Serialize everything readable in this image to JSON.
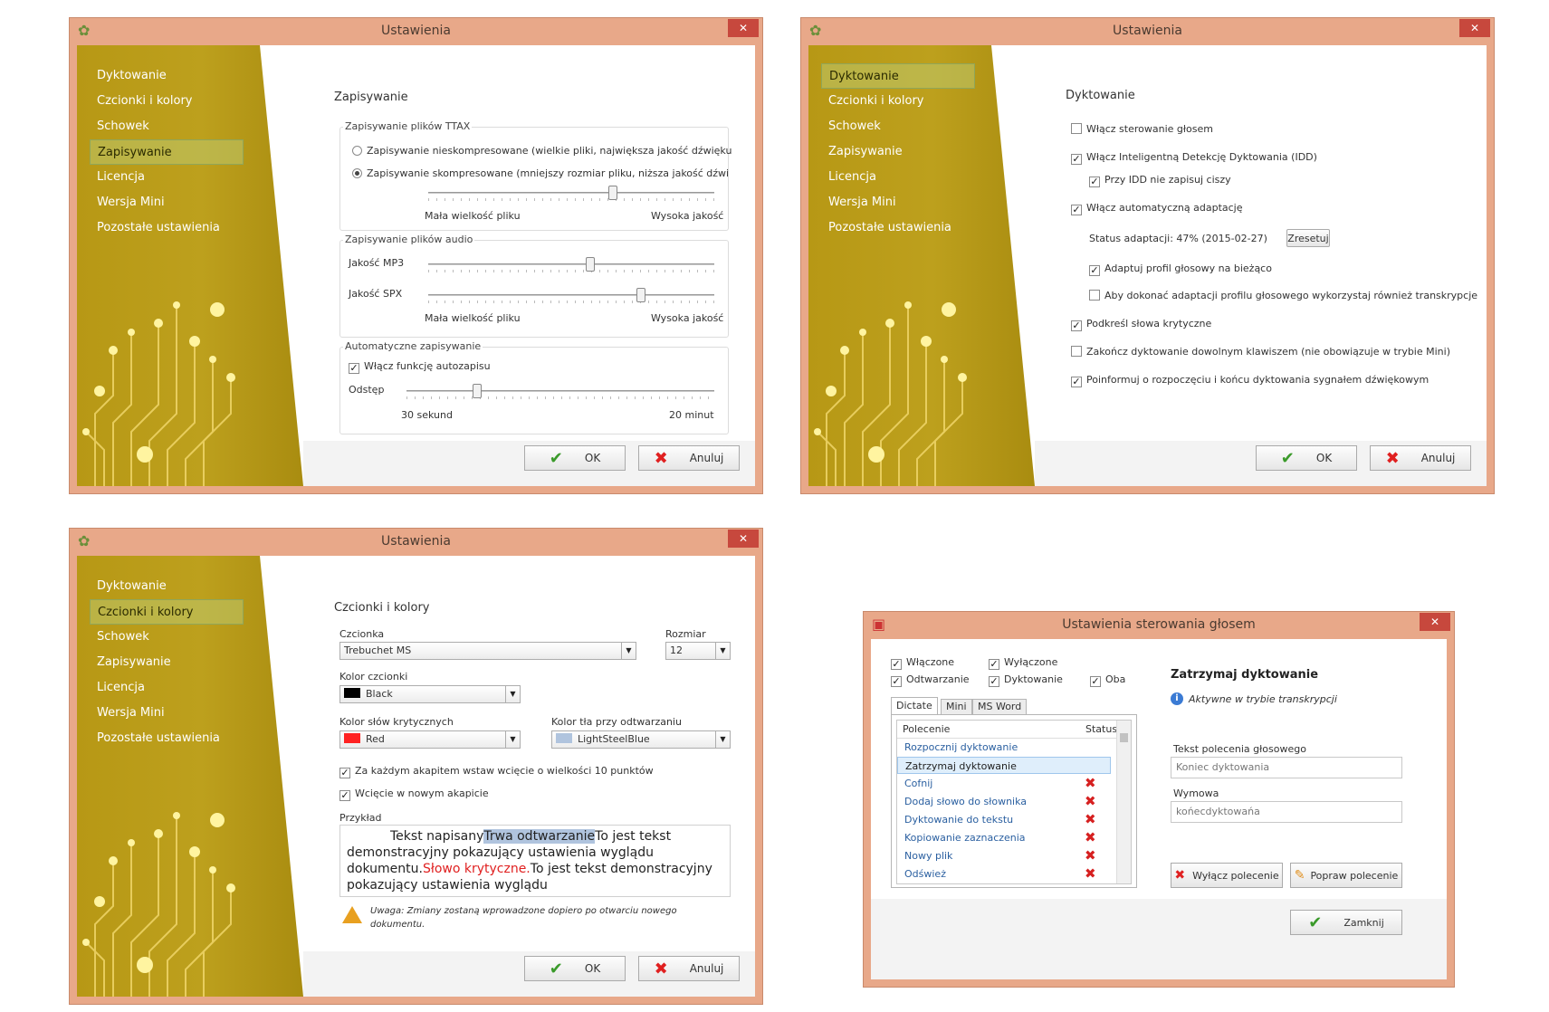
{
  "w1": {
    "title": "Ustawienia",
    "nav": [
      "Dyktowanie",
      "Czcionki i kolory",
      "Schowek",
      "Zapisywanie",
      "Licencja",
      "Wersja Mini",
      "Pozostałe ustawienia"
    ],
    "heading": "Zapisywanie",
    "ttax_group": "Zapisywanie plików TTAX",
    "radio1": "Zapisywanie nieskompresowane (wielkie pliki, największa jakość dźwięku",
    "radio2": "Zapisywanie skompresowane (mniejszy rozmiar pliku, niższa jakość dźwi",
    "small_size": "Mała wielkość pliku",
    "high_quality": "Wysoka jakość",
    "audio_group": "Zapisywanie plików audio",
    "mp3": "Jakość MP3",
    "spx": "Jakość SPX",
    "small_size2": "Mała wielkość pliku",
    "high_quality2": "Wysoka jakość",
    "auto_group": "Automatyczne zapisywanie",
    "autosave": "Włącz funkcję autozapisu",
    "interval": "Odstęp",
    "min": "30 sekund",
    "max": "20 minut",
    "ok": "OK",
    "cancel": "Anuluj",
    "slider_ttax": 0.65,
    "slider_mp3": 0.57,
    "slider_spx": 0.75,
    "slider_interval": 0.22
  },
  "w2": {
    "title": "Ustawienia",
    "nav": [
      "Dyktowanie",
      "Czcionki i kolory",
      "Schowek",
      "Zapisywanie",
      "Licencja",
      "Wersja Mini",
      "Pozostałe ustawienia"
    ],
    "heading": "Dyktowanie",
    "opt1": "Włącz sterowanie głosem",
    "opt2": "Włącz Inteligentną Detekcję Dyktowania (IDD)",
    "opt3": "Przy IDD nie zapisuj ciszy",
    "opt4": "Włącz automatyczną adaptację",
    "status": "Status adaptacji: 47% (2015-02-27)",
    "reset": "Zresetuj",
    "opt5": "Adaptuj profil głosowy na bieżąco",
    "opt6": "Aby dokonać adaptacji profilu głosowego wykorzystaj również transkrypcje",
    "opt7": "Podkreśl słowa krytyczne",
    "opt8": "Zakończ dyktowanie dowolnym klawiszem (nie obowiązuje w trybie Mini)",
    "opt9": "Poinformuj o rozpoczęciu i końcu dyktowania sygnałem dźwiękowym",
    "ok": "OK",
    "cancel": "Anuluj"
  },
  "w3": {
    "title": "Ustawienia",
    "nav": [
      "Dyktowanie",
      "Czcionki i kolory",
      "Schowek",
      "Zapisywanie",
      "Licencja",
      "Wersja Mini",
      "Pozostałe ustawienia"
    ],
    "heading": "Czcionki i kolory",
    "font_label": "Czcionka",
    "font_value": "Trebuchet MS",
    "size_label": "Rozmiar",
    "size_value": "12",
    "fontcolor_label": "Kolor czcionki",
    "fontcolor_value": "Black",
    "critical_label": "Kolor słów krytycznych",
    "critical_value": "Red",
    "playback_label": "Kolor tła przy odtwarzaniu",
    "playback_value": "LightSteelBlue",
    "indent1": "Za każdym akapitem wstaw wcięcie o wielkości 10 punktów",
    "indent2": "Wcięcie w nowym akapicie",
    "example_label": "Przykład",
    "ex_a": "Tekst napisany",
    "ex_b": "Trwa odtwarzanie",
    "ex_c": "To jest tekst demonstracyjny pokazujący ustawienia wyglądu dokumentu.",
    "ex_d": "Słowo krytyczne.",
    "ex_e": "To jest tekst demonstracyjny pokazujący ustawienia wyglądu",
    "warning": "Uwaga: Zmiany zostaną wprowadzone dopiero po otwarciu nowego dokumentu.",
    "ok": "OK",
    "cancel": "Anuluj"
  },
  "w4": {
    "title": "Ustawienia sterowania głosem",
    "f_on": "Włączone",
    "f_off": "Wyłączone",
    "f_play": "Odtwarzanie",
    "f_dict": "Dyktowanie",
    "f_both": "Oba",
    "tabs": [
      "Dictate",
      "Mini",
      "MS Word"
    ],
    "col_cmd": "Polecenie",
    "col_status": "Status",
    "rows": [
      "Rozpocznij dyktowanie",
      "Zatrzymaj dyktowanie",
      "Cofnij",
      "Dodaj słowo do słownika",
      "Dyktowanie do tekstu",
      "Kopiowanie zaznaczenia",
      "Nowy plik",
      "Odśwież"
    ],
    "detail_title": "Zatrzymaj dyktowanie",
    "detail_info": "Aktywne w trybie transkrypcji",
    "cmd_label": "Tekst polecenia głosowego",
    "cmd_value": "Koniec dyktowania",
    "pron_label": "Wymowa",
    "pron_value": "końecdyktowańa",
    "disable_btn": "Wyłącz polecenie",
    "fix_btn": "Popraw polecenie",
    "close_btn": "Zamknij"
  }
}
